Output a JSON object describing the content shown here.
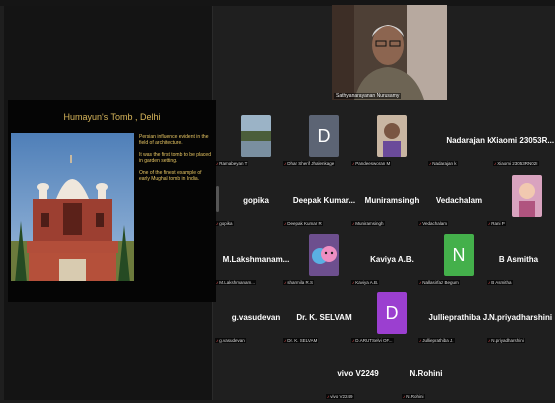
{
  "share": {
    "slide_title": "Humayun's Tomb , Delhi",
    "slide_text": [
      "Persian influence evident in the field of architecture.",
      "It was the first tomb to be placed in garden setting.",
      "One of the finest example of early Mughal tomb in India."
    ]
  },
  "speaker": {
    "label": "Sathyanarayanan Nurusamy"
  },
  "participants": [
    {
      "name": "",
      "sub": "Ramabeyan T",
      "avatar": "lake-photo"
    },
    {
      "name": "",
      "sub": "Dhar Sherif Jhalenkage",
      "avatar": "D"
    },
    {
      "name": "",
      "sub": "Pandeesworan M",
      "avatar": "person-photo"
    },
    {
      "name": "Nadarajan k",
      "sub": "Nadarajan k"
    },
    {
      "name": "Xiaomi 23053R...",
      "sub": "Xiaomi 23053RN02I"
    },
    {
      "name": "gopika",
      "sub": "gopika"
    },
    {
      "name": "Deepak Kumar...",
      "sub": "Deepak Kumar R"
    },
    {
      "name": "Muniramsingh",
      "sub": "Muniramsingh"
    },
    {
      "name": "Vedachalam",
      "sub": "Vedachalam"
    },
    {
      "name": "",
      "sub": "Rani P",
      "avatar": "baby-photo"
    },
    {
      "name": "M.Lakshmanam...",
      "sub": "M.Lakshmanam..."
    },
    {
      "name": "",
      "sub": "sharmila R.S",
      "avatar": "emoji"
    },
    {
      "name": "Kaviya A.B.",
      "sub": "Kaviya A.B."
    },
    {
      "name": "",
      "sub": "Nallasirfaz Begum",
      "avatar": "N"
    },
    {
      "name": "B Asmitha",
      "sub": "B Asmitha"
    },
    {
      "name": "g.vasudevan",
      "sub": "g.vasudevan"
    },
    {
      "name": "Dr. K. SELVAM",
      "sub": "Dr. K. SELVAM"
    },
    {
      "name": "",
      "sub": "D.ARUTSelvi OF...",
      "avatar": "D"
    },
    {
      "name": "Jullieprathiba J.",
      "sub": "Jullieprathiba J."
    },
    {
      "name": "N.priyadharshini",
      "sub": "N.priyadharshini"
    },
    {
      "name": "vivo V2249",
      "sub": "vivo V2249"
    },
    {
      "name": "N.Rohini",
      "sub": "N.Rohini"
    }
  ],
  "colors": {
    "accent_gold": "#d8b65b",
    "mic_off": "#e55555"
  }
}
